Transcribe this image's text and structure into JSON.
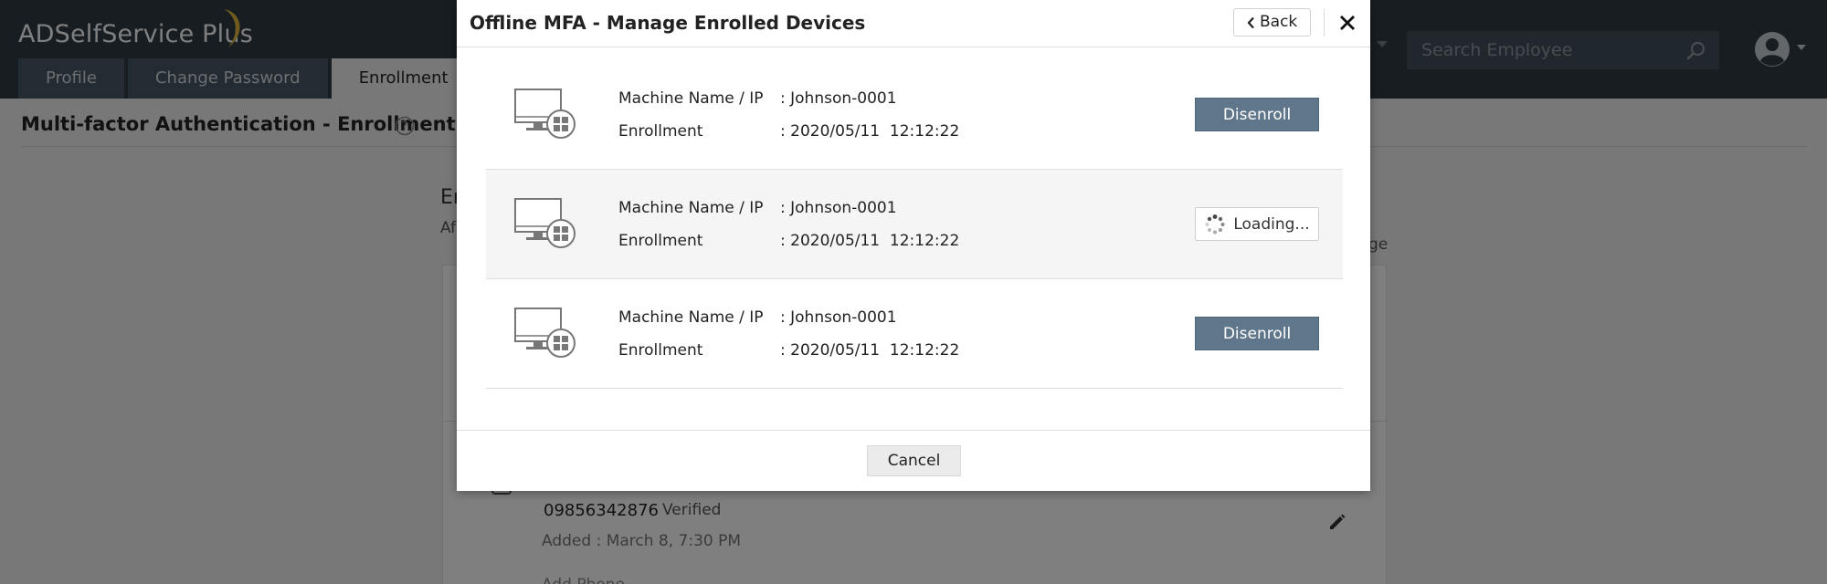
{
  "app": {
    "logo_text": "ADSelfService Plus",
    "nav_tabs": [
      {
        "label": "Profile"
      },
      {
        "label": "Change Password"
      },
      {
        "label": "Enrollment"
      }
    ],
    "search_placeholder": "Search Employee",
    "page_title": "Multi-factor Authentication - Enrollment",
    "bg_heading": "En",
    "bg_sub": "Af",
    "bg_sub_tail": "ge",
    "phone_number": "09856342876",
    "phone_status": "Verified",
    "added_date": "Added : March 8, 7:30 PM",
    "add_phone": "Add Phone"
  },
  "modal": {
    "title": "Offline MFA - Manage Enrolled Devices",
    "back_label": "Back",
    "cancel_label": "Cancel",
    "devices": [
      {
        "machine_label": "Machine Name / IP",
        "machine_value": ": Johnson-0001",
        "enroll_label": "Enrollment",
        "enroll_value": ": 2020/05/11  12:12:22",
        "action_label": "Disenroll"
      },
      {
        "machine_label": "Machine Name / IP",
        "machine_value": ": Johnson-0001",
        "enroll_label": "Enrollment",
        "enroll_value": ": 2020/05/11  12:12:22",
        "action_label": "Loading..."
      },
      {
        "machine_label": "Machine Name / IP",
        "machine_value": ": Johnson-0001",
        "enroll_label": "Enrollment",
        "enroll_value": ": 2020/05/11  12:12:22",
        "action_label": "Disenroll"
      }
    ]
  },
  "colors": {
    "topbar": "#2f3a43",
    "disenroll_button": "#60768a",
    "logo_accent": "#e3b53c"
  }
}
